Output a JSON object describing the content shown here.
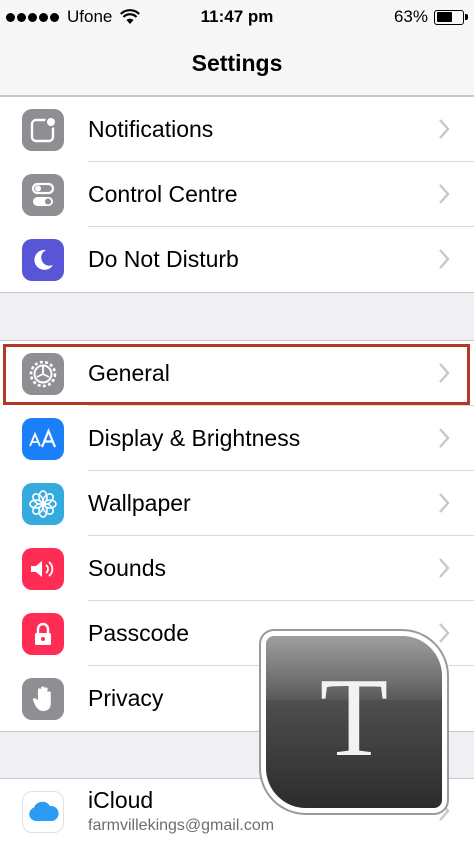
{
  "status_bar": {
    "carrier": "Ufone",
    "time": "11:47 pm",
    "battery_percent": "63%",
    "battery_level": 0.63,
    "signal_bars": 5
  },
  "nav": {
    "title": "Settings"
  },
  "group1": [
    {
      "label": "Notifications",
      "icon": "notifications-icon",
      "color": "#8e8e93"
    },
    {
      "label": "Control Centre",
      "icon": "control-centre-icon",
      "color": "#8e8e93"
    },
    {
      "label": "Do Not Disturb",
      "icon": "moon-icon",
      "color": "#5856d6"
    }
  ],
  "group2": [
    {
      "label": "General",
      "icon": "gear-icon",
      "color": "#8e8e93",
      "highlighted": true
    },
    {
      "label": "Display & Brightness",
      "icon": "text-size-icon",
      "color": "#1a7ff8"
    },
    {
      "label": "Wallpaper",
      "icon": "wallpaper-flower-icon",
      "color": "#35aadc"
    },
    {
      "label": "Sounds",
      "icon": "speaker-icon",
      "color": "#ff2d55"
    },
    {
      "label": "Passcode",
      "icon": "lock-icon",
      "color": "#ff2d55"
    },
    {
      "label": "Privacy",
      "icon": "hand-icon",
      "color": "#8e8e93"
    }
  ],
  "group3": [
    {
      "label": "iCloud",
      "sublabel": "farmvillekings@gmail.com",
      "icon": "cloud-icon",
      "color": "#2b9bf4"
    }
  ],
  "watermark": {
    "letter": "T",
    "icon": "t-app-logo-icon"
  }
}
